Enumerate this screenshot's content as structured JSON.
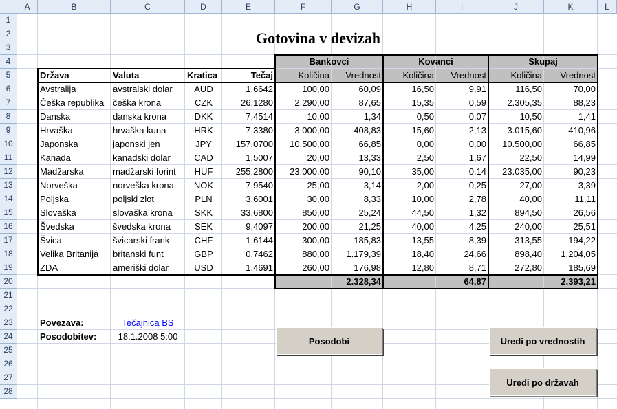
{
  "columns": [
    "A",
    "B",
    "C",
    "D",
    "E",
    "F",
    "G",
    "H",
    "I",
    "J",
    "K",
    "L"
  ],
  "rows": [
    "1",
    "2",
    "3",
    "4",
    "5",
    "6",
    "7",
    "8",
    "9",
    "10",
    "11",
    "12",
    "13",
    "14",
    "15",
    "16",
    "17",
    "18",
    "19",
    "20",
    "21",
    "22",
    "23",
    "24",
    "25",
    "26",
    "27",
    "28"
  ],
  "title": "Gotovina v devizah",
  "groups": {
    "bankovci": "Bankovci",
    "kovanci": "Kovanci",
    "skupaj": "Skupaj"
  },
  "headers": {
    "drzava": "Država",
    "valuta": "Valuta",
    "kratica": "Kratica",
    "tecaj": "Tečaj",
    "kolicina": "Količina",
    "vrednost": "Vrednost"
  },
  "table": [
    [
      "Avstralija",
      "avstralski dolar",
      "AUD",
      "1,6642",
      "100,00",
      "60,09",
      "16,50",
      "9,91",
      "116,50",
      "70,00"
    ],
    [
      "Češka republika",
      "češka krona",
      "CZK",
      "26,1280",
      "2.290,00",
      "87,65",
      "15,35",
      "0,59",
      "2.305,35",
      "88,23"
    ],
    [
      "Danska",
      "danska krona",
      "DKK",
      "7,4514",
      "10,00",
      "1,34",
      "0,50",
      "0,07",
      "10,50",
      "1,41"
    ],
    [
      "Hrvaška",
      "hrvaška kuna",
      "HRK",
      "7,3380",
      "3.000,00",
      "408,83",
      "15,60",
      "2,13",
      "3.015,60",
      "410,96"
    ],
    [
      "Japonska",
      "japonski jen",
      "JPY",
      "157,0700",
      "10.500,00",
      "66,85",
      "0,00",
      "0,00",
      "10.500,00",
      "66,85"
    ],
    [
      "Kanada",
      "kanadski dolar",
      "CAD",
      "1,5007",
      "20,00",
      "13,33",
      "2,50",
      "1,67",
      "22,50",
      "14,99"
    ],
    [
      "Madžarska",
      "madžarski forint",
      "HUF",
      "255,2800",
      "23.000,00",
      "90,10",
      "35,00",
      "0,14",
      "23.035,00",
      "90,23"
    ],
    [
      "Norveška",
      "norveška krona",
      "NOK",
      "7,9540",
      "25,00",
      "3,14",
      "2,00",
      "0,25",
      "27,00",
      "3,39"
    ],
    [
      "Poljska",
      "poljski zlot",
      "PLN",
      "3,6001",
      "30,00",
      "8,33",
      "10,00",
      "2,78",
      "40,00",
      "11,11"
    ],
    [
      "Slovaška",
      "slovaška krona",
      "SKK",
      "33,6800",
      "850,00",
      "25,24",
      "44,50",
      "1,32",
      "894,50",
      "26,56"
    ],
    [
      "Švedska",
      "švedska krona",
      "SEK",
      "9,4097",
      "200,00",
      "21,25",
      "40,00",
      "4,25",
      "240,00",
      "25,51"
    ],
    [
      "Švica",
      "švicarski frank",
      "CHF",
      "1,6144",
      "300,00",
      "185,83",
      "13,55",
      "8,39",
      "313,55",
      "194,22"
    ],
    [
      "Velika Britanija",
      "britanski funt",
      "GBP",
      "0,7462",
      "880,00",
      "1.179,39",
      "18,40",
      "24,66",
      "898,40",
      "1.204,05"
    ],
    [
      "ZDA",
      "ameriški dolar",
      "USD",
      "1,4691",
      "260,00",
      "176,98",
      "12,80",
      "8,71",
      "272,80",
      "185,69"
    ]
  ],
  "totals": {
    "bankovci": "2.328,34",
    "kovanci": "64,87",
    "skupaj": "2.393,21"
  },
  "povezava_label": "Povezava:",
  "povezava_link": "Tečajnica BS",
  "posodobitev_label": "Posodobitev:",
  "posodobitev_value": "18.1.2008 5:00",
  "buttons": {
    "posodobi": "Posodobi",
    "uredi_vrednost": "Uredi po vrednostih",
    "uredi_drzava": "Uredi po državah"
  }
}
